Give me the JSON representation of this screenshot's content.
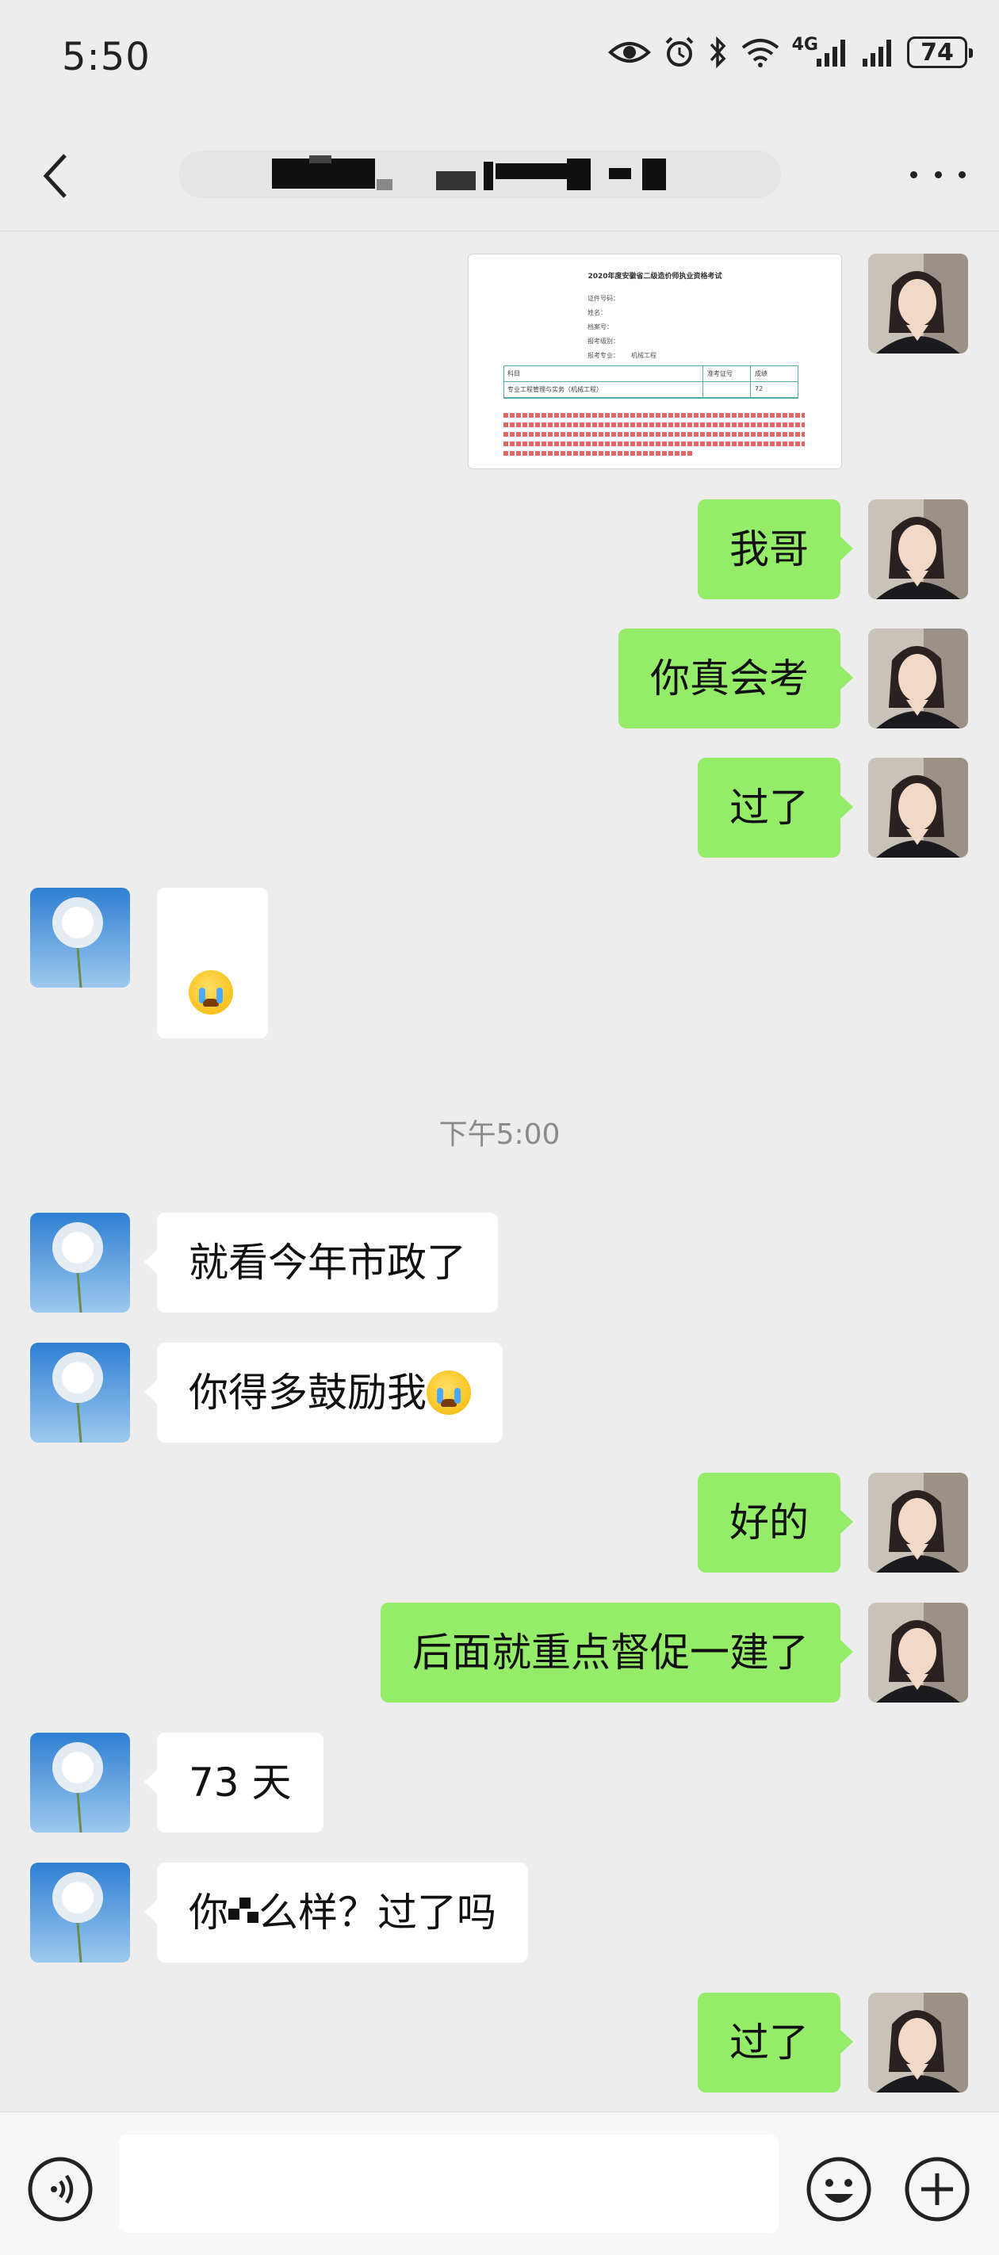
{
  "status_bar": {
    "time": "5:50",
    "network_label": "4G",
    "battery": "74"
  },
  "header": {
    "back_icon": "chevron-left-icon",
    "more_icon": "more-dots-icon"
  },
  "messages": [
    {
      "from": "me",
      "type": "image"
    },
    {
      "from": "me",
      "text": "我哥"
    },
    {
      "from": "me",
      "text": "你真会考"
    },
    {
      "from": "me",
      "text": "过了"
    },
    {
      "from": "them",
      "type": "emoji",
      "emoji": "crying-face-emoji"
    },
    {
      "type": "timestamp",
      "text": "下午5:00"
    },
    {
      "from": "them",
      "text": "就看今年市政了"
    },
    {
      "from": "them",
      "text": "你得多鼓励我",
      "emoji": "crying-face-emoji"
    },
    {
      "from": "me",
      "text": "好的"
    },
    {
      "from": "me",
      "text": "后面就重点督促一建了"
    },
    {
      "from": "them",
      "text": "73 天"
    },
    {
      "from": "them",
      "text_prefix": "你",
      "text_suffix": "么样？过了吗"
    },
    {
      "from": "me",
      "text": "过了"
    }
  ],
  "image_doc": {
    "title": "2020年度安徽省二级造价师执业资格考试",
    "lines": [
      "证件号码：",
      "姓名：",
      "档案号：",
      "报考级别：",
      "报考专业：",
      "机械工程"
    ],
    "col_subject": "科目",
    "col_number": "准考证号",
    "col_score": "成绩",
    "row_subject": "专业工程管理与实务（机械工程）",
    "row_score": "72"
  },
  "colors": {
    "my_bubble": "#95ec69",
    "their_bubble": "#ffffff",
    "background": "#ededed"
  },
  "input_bar": {
    "placeholder": "",
    "voice_icon": "voice-icon",
    "emoji_icon": "smiley-icon",
    "plus_icon": "plus-icon"
  }
}
